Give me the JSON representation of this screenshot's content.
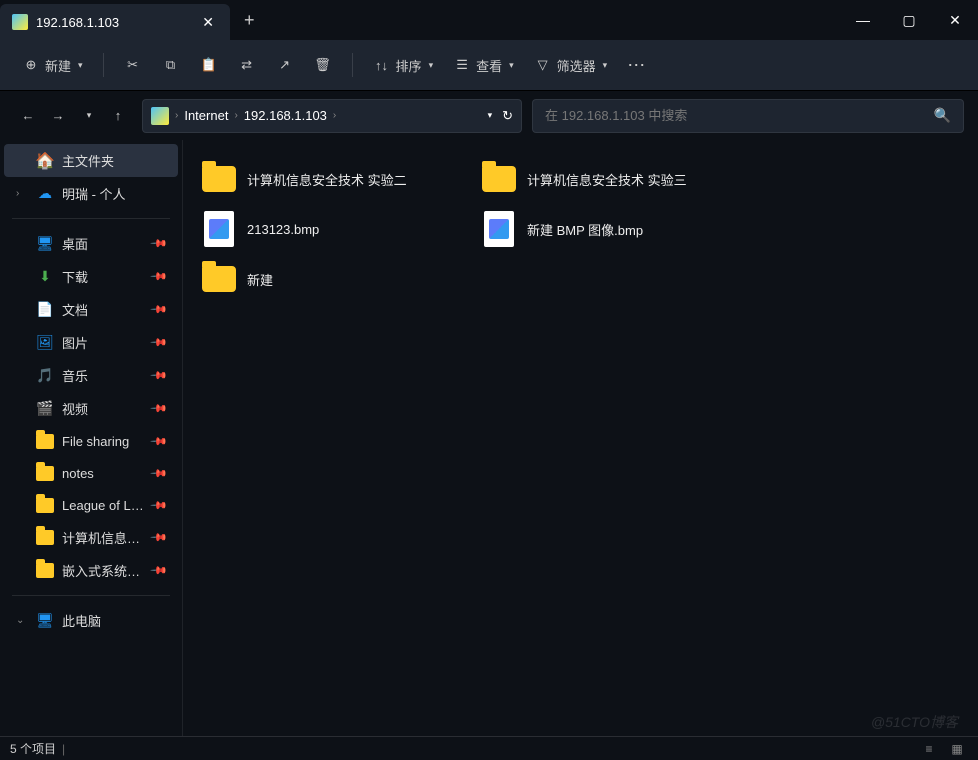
{
  "tab": {
    "title": "192.168.1.103"
  },
  "toolbar": {
    "new_label": "新建",
    "sort_label": "排序",
    "view_label": "查看",
    "filter_label": "筛选器"
  },
  "breadcrumb": {
    "items": [
      "Internet",
      "192.168.1.103"
    ]
  },
  "search": {
    "placeholder": "在 192.168.1.103 中搜索"
  },
  "sidebar": {
    "home_label": "主文件夹",
    "personal_label": "明瑞 - 个人",
    "quick": [
      {
        "label": "桌面",
        "icon": "desktop"
      },
      {
        "label": "下载",
        "icon": "download"
      },
      {
        "label": "文档",
        "icon": "doc"
      },
      {
        "label": "图片",
        "icon": "pic"
      },
      {
        "label": "音乐",
        "icon": "music"
      },
      {
        "label": "视频",
        "icon": "video"
      },
      {
        "label": "File sharing",
        "icon": "folder"
      },
      {
        "label": "notes",
        "icon": "folder"
      },
      {
        "label": "League of Leg",
        "icon": "folder"
      },
      {
        "label": "计算机信息安全",
        "icon": "folder"
      },
      {
        "label": "嵌入式系统应用",
        "icon": "folder"
      }
    ],
    "this_pc_label": "此电脑"
  },
  "files": [
    {
      "name": "计算机信息安全技术 实验二",
      "type": "folder"
    },
    {
      "name": "计算机信息安全技术 实验三",
      "type": "folder"
    },
    {
      "name": "213123.bmp",
      "type": "bmp"
    },
    {
      "name": "新建 BMP 图像.bmp",
      "type": "bmp"
    },
    {
      "name": "新建",
      "type": "folder"
    }
  ],
  "status": {
    "count_text": "5 个项目"
  },
  "watermark": "@51CTO博客"
}
